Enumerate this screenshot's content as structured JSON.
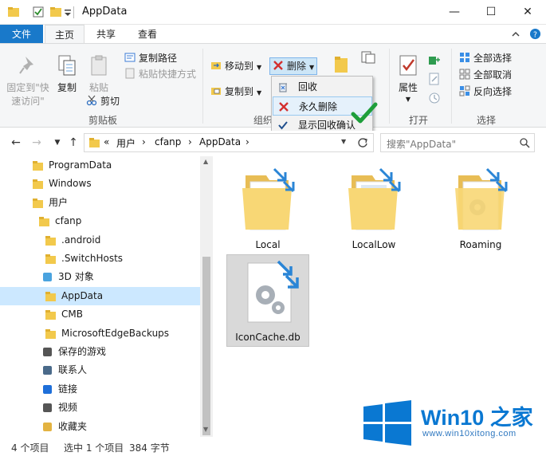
{
  "window": {
    "title": "AppData",
    "minimize": "—",
    "maximize": "☐",
    "close": "✕"
  },
  "ribbon_tabs": {
    "file": "文件",
    "home": "主页",
    "share": "共享",
    "view": "查看"
  },
  "ribbon": {
    "clipboard": {
      "pin_line1": "固定到\"快",
      "pin_line2": "速访问\"",
      "copy": "复制",
      "paste": "粘贴",
      "copy_path": "复制路径",
      "paste_shortcut": "粘贴快捷方式",
      "cut": "剪切",
      "group_label": "剪贴板"
    },
    "organize": {
      "move_to": "移动到",
      "copy_to": "复制到",
      "delete": "删除",
      "group_label": "组织"
    },
    "open": {
      "properties": "属性",
      "group_label": "打开"
    },
    "select": {
      "select_all": "全部选择",
      "select_none": "全部取消",
      "invert": "反向选择",
      "group_label": "选择"
    }
  },
  "delete_menu": {
    "recycle": "回收",
    "permanent": "永久删除",
    "show_confirm": "显示回收确认"
  },
  "address": {
    "overflow": "«",
    "crumbs": [
      "用户",
      "cfanp",
      "AppData"
    ],
    "separator": "›",
    "search_placeholder": "搜索\"AppData\""
  },
  "nav_tree": [
    {
      "label": "ProgramData",
      "icon": "folder-icon"
    },
    {
      "label": "Windows",
      "icon": "folder-icon"
    },
    {
      "label": "用户",
      "icon": "folder-icon"
    },
    {
      "label": "cfanp",
      "icon": "folder-icon"
    },
    {
      "label": ".android",
      "icon": "folder-icon"
    },
    {
      "label": ".SwitchHosts",
      "icon": "folder-icon"
    },
    {
      "label": "3D 对象",
      "icon": "3d-objects-icon"
    },
    {
      "label": "AppData",
      "icon": "folder-icon"
    },
    {
      "label": "CMB",
      "icon": "folder-icon"
    },
    {
      "label": "MicrosoftEdgeBackups",
      "icon": "folder-icon"
    },
    {
      "label": "保存的游戏",
      "icon": "saved-games-icon"
    },
    {
      "label": "联系人",
      "icon": "contacts-icon"
    },
    {
      "label": "链接",
      "icon": "links-icon"
    },
    {
      "label": "视频",
      "icon": "videos-icon"
    },
    {
      "label": "收藏夹",
      "icon": "favorites-icon"
    }
  ],
  "items": [
    {
      "label": "Local",
      "type": "folder"
    },
    {
      "label": "LocalLow",
      "type": "folder"
    },
    {
      "label": "Roaming",
      "type": "folder"
    },
    {
      "label": "IconCache.db",
      "type": "file"
    }
  ],
  "status": {
    "count": "4 个项目",
    "selected": "选中 1 个项目",
    "size": "384 字节"
  },
  "watermark": {
    "title": "Win10 之家",
    "url": "www.win10xitong.com"
  },
  "colors": {
    "accent": "#1979ca",
    "folder": "#f8d775",
    "selection": "#cce8ff",
    "delete_red": "#d32f2f"
  }
}
